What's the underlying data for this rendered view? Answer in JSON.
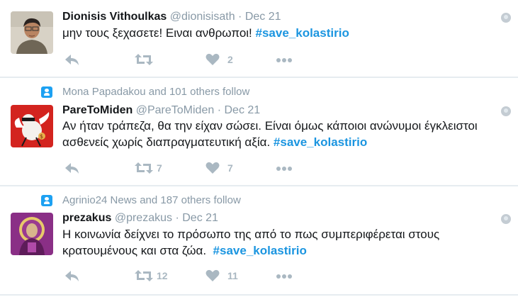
{
  "tweets": [
    {
      "context": "",
      "name": "Dionisis Vithoulkas",
      "handle": "@dionisisath",
      "sep": "·",
      "date": "Dec 21",
      "text_lines": [
        "μην τους ξεχασετε! Ειναι ανθρωποι! "
      ],
      "hashtag": "#save_kolastirio",
      "retweets": "",
      "likes": "2"
    },
    {
      "context": "Mona Papadakou and 101 others follow",
      "name": "PareToMiden",
      "handle": "@PareToMiden",
      "sep": "·",
      "date": "Dec 21",
      "text_lines": [
        "Αν ήταν τράπεζα, θα την είχαν σώσει. Είναι όμως κάποιοι ανώνυμοι έγκλειστοι",
        "ασθενείς χωρίς διαπραγματευτική αξία. "
      ],
      "hashtag": "#save_kolastirio",
      "retweets": "7",
      "likes": "7"
    },
    {
      "context": "Agrinio24 News and 187 others follow",
      "name": "prezakus",
      "handle": "@prezakus",
      "sep": "·",
      "date": "Dec 21",
      "text_lines": [
        "Η κοινωνία δείχνει το πρόσωπο της από το πως συμπεριφέρεται στους",
        "κρατουμένους και στα ζώα.  "
      ],
      "hashtag": "#save_kolastirio",
      "retweets": "12",
      "likes": "11"
    }
  ],
  "colors": {
    "hashtag": "#1b95e0",
    "meta": "#8899a6",
    "action": "#aab8c2",
    "context_icon": "#1da1f2"
  },
  "icons": {
    "reply": "reply-icon",
    "retweet": "retweet-icon",
    "like": "heart-icon",
    "more": "more-icon",
    "context": "follow-context-icon",
    "globe": "globe-icon"
  }
}
